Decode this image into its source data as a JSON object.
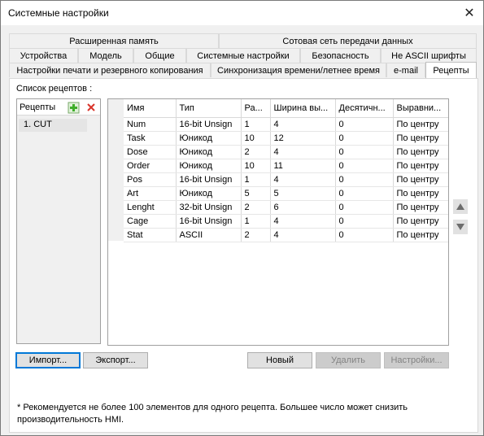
{
  "window": {
    "title": "Системные настройки"
  },
  "tabs": {
    "row1": [
      "Расширенная память",
      "Сотовая сеть передачи данных"
    ],
    "row2": [
      "Устройства",
      "Модель",
      "Общие",
      "Системные настройки",
      "Безопасность",
      "Не ASCII шрифты"
    ],
    "row3": [
      "Настройки печати и резервного копирования",
      "Синхронизация времени/летнее время",
      "e-mail",
      "Рецепты"
    ],
    "active": "Рецепты"
  },
  "recipes_panel": {
    "section_label": "Список рецептов :",
    "list_header": "Рецепты",
    "items": [
      "1. CUT"
    ]
  },
  "grid": {
    "columns": [
      "Имя",
      "Тип",
      "Ра...",
      "Ширина вы...",
      "Десятичн...",
      "Выравни..."
    ],
    "rows": [
      [
        "Num",
        "16-bit Unsign",
        "1",
        "4",
        "0",
        "По центру"
      ],
      [
        "Task",
        "Юникод",
        "10",
        "12",
        "0",
        "По центру"
      ],
      [
        "Dose",
        "Юникод",
        "2",
        "4",
        "0",
        "По центру"
      ],
      [
        "Order",
        "Юникод",
        "10",
        "11",
        "0",
        "По центру"
      ],
      [
        "Pos",
        "16-bit Unsign",
        "1",
        "4",
        "0",
        "По центру"
      ],
      [
        "Art",
        "Юникод",
        "5",
        "5",
        "0",
        "По центру"
      ],
      [
        "Lenght",
        "32-bit Unsign",
        "2",
        "6",
        "0",
        "По центру"
      ],
      [
        "Cage",
        "16-bit Unsign",
        "1",
        "4",
        "0",
        "По центру"
      ],
      [
        "Stat",
        "ASCII",
        "2",
        "4",
        "0",
        "По центру"
      ]
    ]
  },
  "buttons": {
    "import": "Импорт...",
    "export": "Экспорт...",
    "new": "Новый",
    "delete": "Удалить",
    "settings": "Настройки..."
  },
  "footnote": "* Рекомендуется не более 100 элементов для одного рецепта. Большее число может снизить производительность HMI.",
  "icons": {
    "add": "add-recipe-icon",
    "delete": "delete-recipe-icon",
    "up": "move-up-icon",
    "down": "move-down-icon",
    "close": "close-icon"
  },
  "colors": {
    "add_icon": "#3fae2a",
    "delete_icon": "#d9342b",
    "focus_border": "#0078d7"
  }
}
